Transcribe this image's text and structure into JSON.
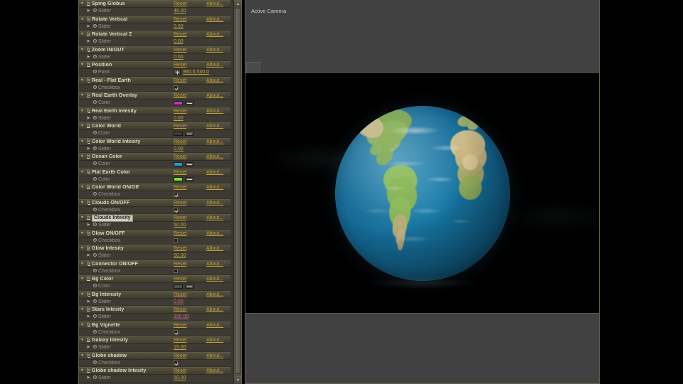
{
  "viewer": {
    "label": "Active Camera",
    "tab_name": "comp-thumbnail-tab"
  },
  "effect_controls": {
    "columns": {
      "reset": "Reset",
      "about": "About..."
    },
    "selected_property": "Clouds Intesity",
    "rows": [
      {
        "kind": "effect",
        "name": "Sping Globus",
        "reset": "Reset",
        "about": "About..."
      },
      {
        "kind": "prop",
        "name": "Slider",
        "ctl": "value",
        "value": "46.00",
        "expr": false
      },
      {
        "kind": "effect",
        "name": "Rotate Vertical",
        "reset": "Reset",
        "about": "About..."
      },
      {
        "kind": "prop",
        "name": "Slider",
        "ctl": "value",
        "value": "0.00",
        "expr": false
      },
      {
        "kind": "effect",
        "name": "Rotate Vertical Z",
        "reset": "Reset",
        "about": "About..."
      },
      {
        "kind": "prop",
        "name": "Slider",
        "ctl": "value",
        "value": "0.00",
        "expr": false
      },
      {
        "kind": "effect",
        "name": "Zoom IN/OUT",
        "reset": "Reset",
        "about": "About..."
      },
      {
        "kind": "prop",
        "name": "Slider",
        "ctl": "value",
        "value": "0.00",
        "expr": false
      },
      {
        "kind": "effect",
        "name": "Position",
        "reset": "Reset",
        "about": "About..."
      },
      {
        "kind": "prop",
        "name": "Point",
        "ctl": "point",
        "value": "960.0,540.0",
        "expr": false
      },
      {
        "kind": "effect",
        "name": "Real - Flat Earth",
        "reset": "Reset",
        "about": "About..."
      },
      {
        "kind": "prop",
        "name": "Checkbox",
        "ctl": "checkbox",
        "checked": true
      },
      {
        "kind": "effect",
        "name": "Real Earth Overlay",
        "reset": "Reset",
        "about": "About..."
      },
      {
        "kind": "prop",
        "name": "Color",
        "ctl": "color",
        "color": "#c832d2"
      },
      {
        "kind": "effect",
        "name": "Real Earth Intesity",
        "reset": "Reset",
        "about": "About..."
      },
      {
        "kind": "prop",
        "name": "Slider",
        "ctl": "value",
        "value": "0.00",
        "expr": false
      },
      {
        "kind": "effect",
        "name": "Color World",
        "reset": "Reset",
        "about": "About..."
      },
      {
        "kind": "prop",
        "name": "Color",
        "ctl": "color",
        "color": "#3c3c3c"
      },
      {
        "kind": "effect",
        "name": "Color World Intesity",
        "reset": "Reset",
        "about": "About..."
      },
      {
        "kind": "prop",
        "name": "Slider",
        "ctl": "value",
        "value": "0.00",
        "expr": false
      },
      {
        "kind": "effect",
        "name": "Ocean Color",
        "reset": "Reset",
        "about": "About..."
      },
      {
        "kind": "prop",
        "name": "Color",
        "ctl": "color",
        "color": "#1f9fd2"
      },
      {
        "kind": "effect",
        "name": "Flat Earth Color",
        "reset": "Reset",
        "about": "About..."
      },
      {
        "kind": "prop",
        "name": "Color",
        "ctl": "color",
        "color": "#8ae022"
      },
      {
        "kind": "effect",
        "name": "Color World ON/Off",
        "reset": "Reset",
        "about": "About..."
      },
      {
        "kind": "prop",
        "name": "Checkbox",
        "ctl": "checkbox",
        "checked": true
      },
      {
        "kind": "effect",
        "name": "Clouds ON/OFF",
        "reset": "Reset",
        "about": "About..."
      },
      {
        "kind": "prop",
        "name": "Checkbox",
        "ctl": "checkbox",
        "checked": true
      },
      {
        "kind": "effect",
        "name": "Clouds Intesity",
        "reset": "Reset",
        "about": "About...",
        "selected": true
      },
      {
        "kind": "prop",
        "name": "Slider",
        "ctl": "value",
        "value": "50.00",
        "expr": false
      },
      {
        "kind": "effect",
        "name": "Glow ON/OFF",
        "reset": "Reset",
        "about": "About..."
      },
      {
        "kind": "prop",
        "name": "Checkbox",
        "ctl": "checkbox",
        "checked": false
      },
      {
        "kind": "effect",
        "name": "Glow Intesity",
        "reset": "Reset",
        "about": "About..."
      },
      {
        "kind": "prop",
        "name": "Slider",
        "ctl": "value",
        "value": "50.00",
        "expr": false
      },
      {
        "kind": "effect",
        "name": "Connector ON/OFF",
        "reset": "Reset",
        "about": "About..."
      },
      {
        "kind": "prop",
        "name": "Checkbox",
        "ctl": "checkbox",
        "checked": false
      },
      {
        "kind": "effect",
        "name": "Bg Color",
        "reset": "Reset",
        "about": "About..."
      },
      {
        "kind": "prop",
        "name": "Color",
        "ctl": "color",
        "color": "#4a5448"
      },
      {
        "kind": "effect",
        "name": "Bg Intensity",
        "reset": "Reset",
        "about": "About..."
      },
      {
        "kind": "prop",
        "name": "Slider",
        "ctl": "value",
        "value": "0.00",
        "expr": true
      },
      {
        "kind": "effect",
        "name": "Stars Intesity",
        "reset": "Reset",
        "about": "About..."
      },
      {
        "kind": "prop",
        "name": "Slider",
        "ctl": "value",
        "value": "100.00",
        "expr": true
      },
      {
        "kind": "effect",
        "name": "Bg Vignette",
        "reset": "Reset",
        "about": "About..."
      },
      {
        "kind": "prop",
        "name": "Checkbox",
        "ctl": "checkbox",
        "checked": true
      },
      {
        "kind": "effect",
        "name": "Galaxy Intesity",
        "reset": "Reset",
        "about": "About..."
      },
      {
        "kind": "prop",
        "name": "Slider",
        "ctl": "value",
        "value": "15.00",
        "expr": false
      },
      {
        "kind": "effect",
        "name": "Globe shadow",
        "reset": "Reset",
        "about": "About..."
      },
      {
        "kind": "prop",
        "name": "Checkbox",
        "ctl": "checkbox",
        "checked": true
      },
      {
        "kind": "effect",
        "name": "Globe shadow Intesity",
        "reset": "Reset",
        "about": "About..."
      },
      {
        "kind": "prop",
        "name": "Slider",
        "ctl": "value",
        "value": "50.00",
        "expr": false
      }
    ]
  },
  "scrollbar": {
    "up": "▲",
    "down": "▼"
  },
  "colors": {
    "panel_bg": "#3a3a35",
    "effect_row": "#4a4736",
    "link": "#c8a03c",
    "value": "#c2a445",
    "value_expression": "#c96a7d",
    "selection": "#cfcdc4",
    "viewer_chrome": "#414141",
    "canvas_bg": "#000000"
  }
}
